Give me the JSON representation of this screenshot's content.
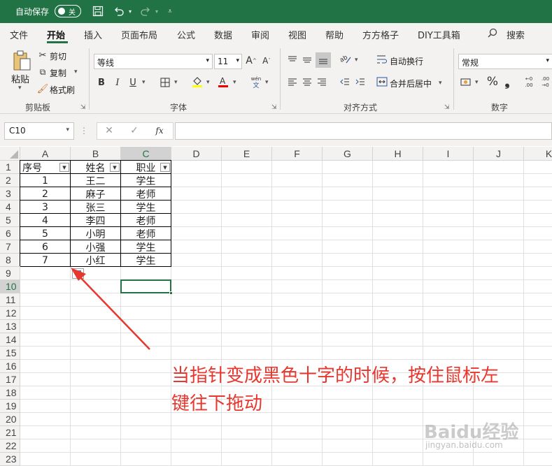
{
  "titlebar": {
    "autosave_label": "自动保存",
    "autosave_state": "关",
    "bg_color": "#217346"
  },
  "tabs": [
    "文件",
    "开始",
    "插入",
    "页面布局",
    "公式",
    "数据",
    "审阅",
    "视图",
    "帮助",
    "方方格子",
    "DIY工具箱",
    "搜索"
  ],
  "active_tab": "开始",
  "ribbon": {
    "clipboard": {
      "paste": "粘贴",
      "cut": "剪切",
      "copy": "复制",
      "format_painter": "格式刷",
      "label": "剪贴板"
    },
    "font": {
      "name": "等线",
      "size": "11",
      "label": "字体",
      "bold": "B",
      "italic": "I",
      "underline": "U"
    },
    "align": {
      "wrap": "自动换行",
      "merge": "合并后居中",
      "label": "对齐方式"
    },
    "number": {
      "format": "常规",
      "label": "数字",
      "percent": "%"
    }
  },
  "formula_bar": {
    "name_box": "C10",
    "fx": "fx",
    "value": ""
  },
  "grid": {
    "columns": [
      "A",
      "B",
      "C",
      "D",
      "E",
      "F",
      "G",
      "H",
      "I",
      "J",
      "K"
    ],
    "rows": [
      "1",
      "2",
      "3",
      "4",
      "5",
      "6",
      "7",
      "8",
      "9",
      "10",
      "11",
      "12",
      "13",
      "14",
      "15",
      "16",
      "17",
      "18",
      "19",
      "20",
      "21",
      "22",
      "23"
    ],
    "selected_cell": "C10",
    "table": {
      "headers": [
        "序号",
        "姓名",
        "职业"
      ],
      "rows": [
        [
          "1",
          "王二",
          "学生"
        ],
        [
          "2",
          "麻子",
          "老师"
        ],
        [
          "3",
          "张三",
          "学生"
        ],
        [
          "4",
          "李四",
          "老师"
        ],
        [
          "5",
          "小明",
          "老师"
        ],
        [
          "6",
          "小强",
          "学生"
        ],
        [
          "7",
          "小红",
          "学生"
        ]
      ]
    }
  },
  "annotation": {
    "text_line1": "当指针变成黑色十字的时候，按住鼠标左",
    "text_line2": "键往下拖动",
    "color": "#e8372e"
  },
  "watermark": {
    "brand": "Baidu经验",
    "url": "jingyan.baidu.com"
  }
}
